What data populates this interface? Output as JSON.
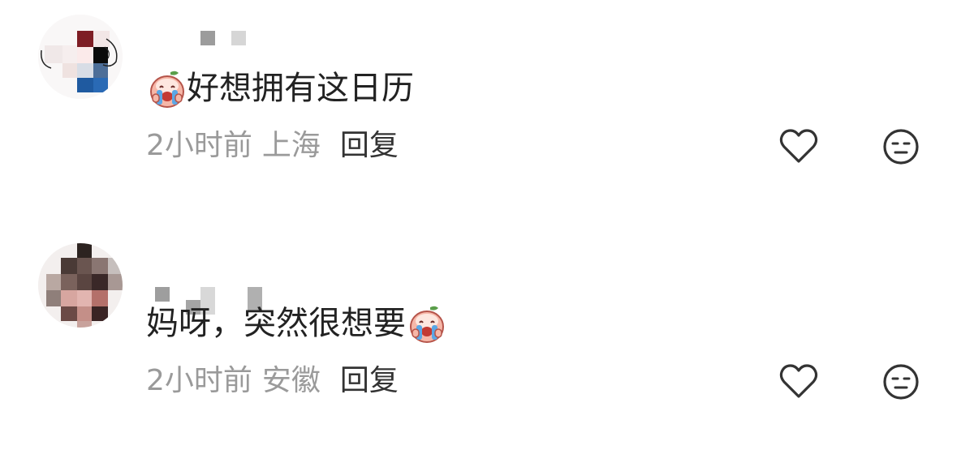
{
  "comments": [
    {
      "content": "好想拥有这日历",
      "time": "2小时前",
      "location": "上海",
      "reply_label": "回复",
      "emoji_position": "before",
      "emoji": "crying-peach-emoji"
    },
    {
      "content": "妈呀，突然很想要",
      "time": "2小时前",
      "location": "安徽",
      "reply_label": "回复",
      "emoji_position": "after",
      "emoji": "crying-peach-emoji"
    }
  ],
  "icons": {
    "like": "heart-outline-icon",
    "reaction": "neutral-face-icon"
  },
  "colors": {
    "text_primary": "#222222",
    "text_secondary": "#9a9a9a",
    "reply": "#333333",
    "icon": "#333333"
  }
}
